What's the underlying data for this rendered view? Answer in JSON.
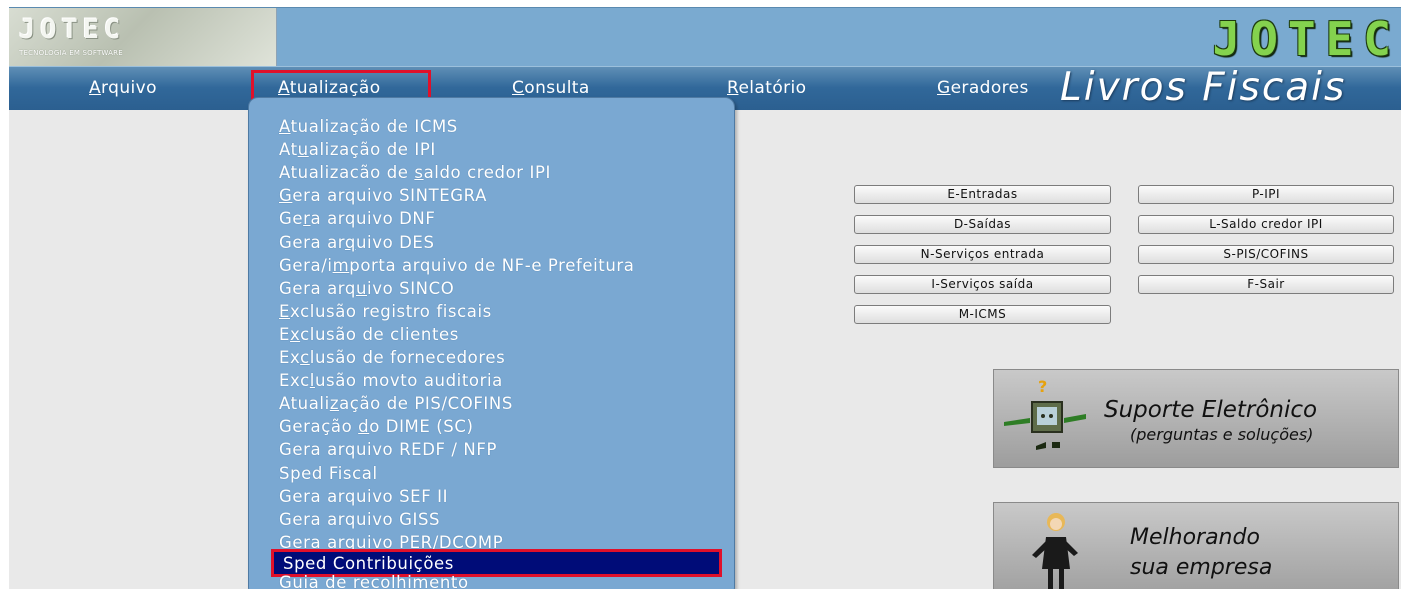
{
  "header": {
    "logo_text": "JOTEC",
    "logo_subtitle": "TECNOLOGIA EM SOFTWARE",
    "brand_right": "JOTEC",
    "module_title": "Livros Fiscais",
    "colors": {
      "header_bg": "#7aaad0",
      "menubar_bg": "#31689a",
      "brand_green": "#84d24e",
      "highlight_red": "#e0102a"
    }
  },
  "menubar": {
    "arquivo": {
      "mnemonic": "A",
      "rest": "rquivo"
    },
    "atualizacao": {
      "mnemonic": "A",
      "rest": "tualização"
    },
    "consulta": {
      "mnemonic": "C",
      "rest": "onsulta"
    },
    "relatorio": {
      "mnemonic": "R",
      "rest": "elatório"
    },
    "geradores": {
      "mnemonic": "G",
      "rest": "eradores"
    }
  },
  "dropdown": {
    "items": [
      {
        "pre": "",
        "ul": "A",
        "post": "tualização de ICMS"
      },
      {
        "pre": "At",
        "ul": "u",
        "post": "alização de IPI"
      },
      {
        "pre": "Atualizacão de ",
        "ul": "s",
        "post": "aldo credor IPI"
      },
      {
        "pre": "",
        "ul": "G",
        "post": "era arquivo SINTEGRA"
      },
      {
        "pre": "Ge",
        "ul": "r",
        "post": "a arquivo DNF"
      },
      {
        "pre": "Gera ar",
        "ul": "q",
        "post": "uivo DES"
      },
      {
        "pre": "Gera/i",
        "ul": "m",
        "post": "porta arquivo de NF-e Prefeitura"
      },
      {
        "pre": "Gera arq",
        "ul": "u",
        "post": "ivo SINCO"
      },
      {
        "pre": "",
        "ul": "E",
        "post": "xclusão registro fiscais"
      },
      {
        "pre": "E",
        "ul": "x",
        "post": "clusão de clientes"
      },
      {
        "pre": "Ex",
        "ul": "c",
        "post": "lusão de fornecedores"
      },
      {
        "pre": "Exc",
        "ul": "l",
        "post": "usão movto auditoria"
      },
      {
        "pre": "Atuali",
        "ul": "z",
        "post": "ação de PIS/COFINS"
      },
      {
        "pre": "Geração ",
        "ul": "d",
        "post": "o DIME (SC)"
      },
      {
        "pre": "Gera arquivo REDF / NFP",
        "ul": "",
        "post": ""
      },
      {
        "pre": "Sped Fiscal",
        "ul": "",
        "post": ""
      },
      {
        "pre": "Gera arquivo SEF II",
        "ul": "",
        "post": ""
      },
      {
        "pre": "Gera arquivo GISS",
        "ul": "",
        "post": ""
      },
      {
        "pre": "Gera arquivo PER/DCOMP",
        "ul": "",
        "post": ""
      }
    ],
    "selected": "Sped Contribuições",
    "partial_last": "Guia de recolhimento"
  },
  "buttons": {
    "entradas": "E-Entradas",
    "saidas": "D-Saídas",
    "servicos_entrada": "N-Serviços entrada",
    "servicos_saida": "I-Serviços saída",
    "icms": "M-ICMS",
    "ipi": "P-IPI",
    "saldo_credor_ipi": "L-Saldo credor IPI",
    "pis_cofins": "S-PIS/COFINS",
    "sair": "F-Sair"
  },
  "promos": {
    "suporte_title": "Suporte Eletrônico",
    "suporte_subtitle": "(perguntas e soluções)",
    "melhorando_line1": "Melhorando",
    "melhorando_line2": "sua empresa"
  }
}
